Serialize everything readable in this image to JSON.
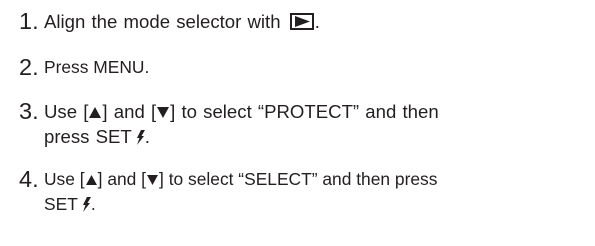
{
  "steps": [
    {
      "number": "1.",
      "text_before": "Align the mode selector with",
      "icon": "play-mode-icon",
      "text_after": "."
    },
    {
      "number": "2.",
      "text": "Press MENU."
    },
    {
      "number": "3.",
      "use": "Use",
      "and": "and",
      "line1_rest": "to select “PROTECT” and then",
      "line2": "press SET",
      "line2_end": "."
    },
    {
      "number": "4.",
      "use": "Use",
      "and": "and",
      "line1_rest": "to select “SELECT” and then press",
      "line2": "SET",
      "line2_end": "."
    }
  ],
  "icons": {
    "up": "up-arrow-button-icon",
    "down": "down-arrow-button-icon",
    "flash": "flash-icon",
    "play": "play-mode-icon"
  },
  "colors": {
    "text": "#231f20"
  }
}
